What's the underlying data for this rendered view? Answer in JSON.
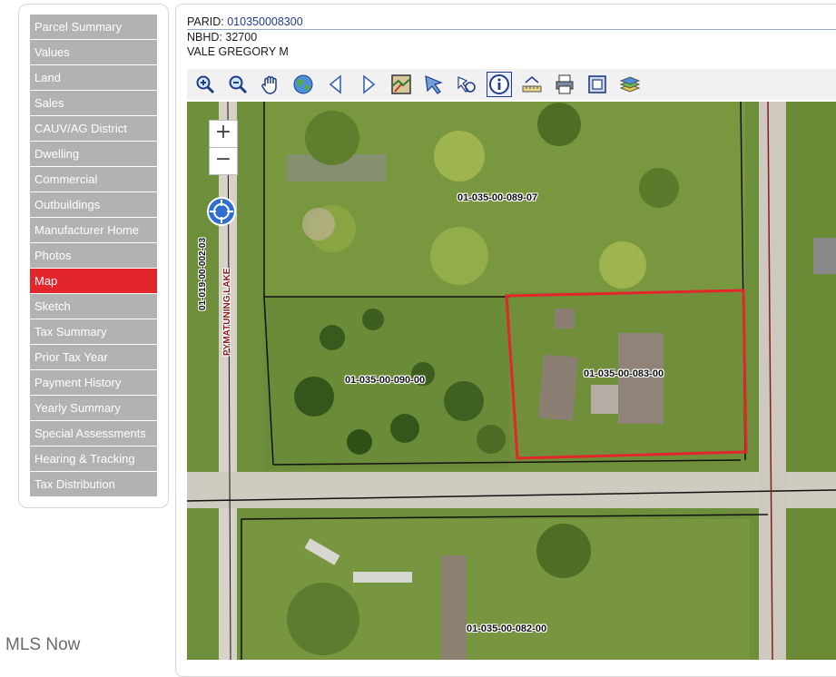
{
  "sidebar": {
    "items": [
      {
        "label": "Parcel Summary"
      },
      {
        "label": "Values"
      },
      {
        "label": "Land"
      },
      {
        "label": "Sales"
      },
      {
        "label": "CAUV/AG District"
      },
      {
        "label": "Dwelling"
      },
      {
        "label": "Commercial"
      },
      {
        "label": "Outbuildings"
      },
      {
        "label": "Manufacturer Home"
      },
      {
        "label": "Photos"
      },
      {
        "label": "Map",
        "active": true
      },
      {
        "label": "Sketch"
      },
      {
        "label": "Tax Summary"
      },
      {
        "label": "Prior Tax Year"
      },
      {
        "label": "Payment History"
      },
      {
        "label": "Yearly Summary"
      },
      {
        "label": "Special Assessments"
      },
      {
        "label": "Hearing & Tracking"
      },
      {
        "label": "Tax Distribution"
      }
    ]
  },
  "parcel": {
    "parid_label": "PARID:",
    "parid_value": "010350008300",
    "nbhd_label": "NBHD:",
    "nbhd_value": "32700",
    "owner": "VALE GREGORY M"
  },
  "toolbar": {
    "tools": [
      {
        "icon": "zoom-in-icon"
      },
      {
        "icon": "zoom-out-icon"
      },
      {
        "icon": "pan-hand-icon"
      },
      {
        "icon": "globe-icon"
      },
      {
        "icon": "previous-extent-icon"
      },
      {
        "icon": "next-extent-icon"
      },
      {
        "icon": "map-identify-icon"
      },
      {
        "icon": "select-arrow-icon"
      },
      {
        "icon": "select-shape-icon"
      },
      {
        "icon": "info-icon",
        "active": true
      },
      {
        "icon": "measure-icon"
      },
      {
        "icon": "print-icon"
      },
      {
        "icon": "full-extent-icon"
      },
      {
        "icon": "layers-icon"
      }
    ]
  },
  "map": {
    "zoom_in": "+",
    "zoom_out": "−",
    "parcel_labels": [
      "01-035-00-089-07",
      "01-035-00-090-00",
      "01-035-00-083-00",
      "01-035-00-082-00"
    ],
    "road_label_1": "01-019-00-002-03",
    "road_label_2": "PYMATUNING LAKE",
    "colors": {
      "selection": "#e3262c",
      "road": "#d6d2c8"
    }
  },
  "watermark": "MLS Now",
  "colors": {
    "nav_active": "#e3262c",
    "nav_inactive": "#b2b2b2",
    "link": "#1f3c88"
  }
}
